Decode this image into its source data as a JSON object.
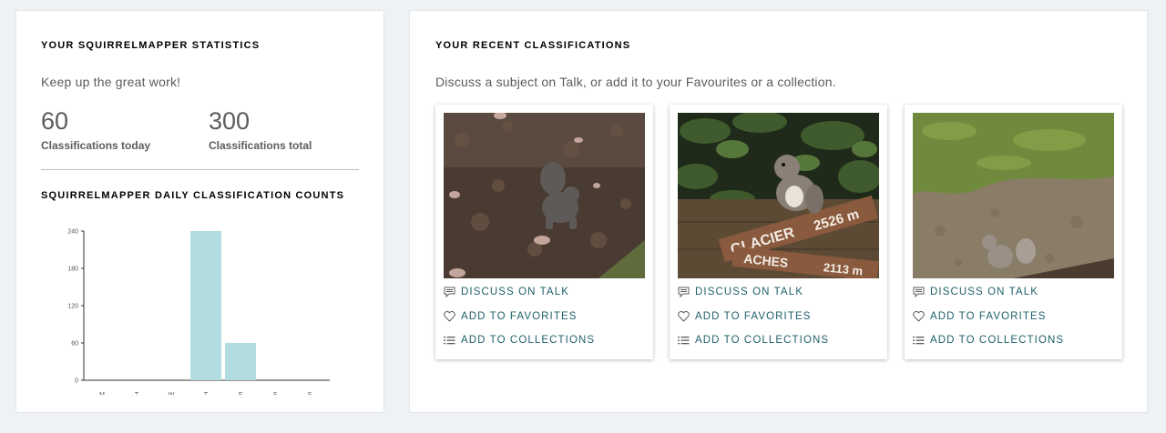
{
  "stats": {
    "heading": "YOUR SQUIRRELMAPPER STATISTICS",
    "subtitle": "Keep up the great work!",
    "today_value": "60",
    "today_label": "Classifications today",
    "total_value": "300",
    "total_label": "Classifications total"
  },
  "daily": {
    "heading": "SQUIRRELMAPPER DAILY CLASSIFICATION COUNTS"
  },
  "chart_data": {
    "type": "bar",
    "categories": [
      "M",
      "T",
      "W",
      "T",
      "F",
      "S",
      "S"
    ],
    "values": [
      0,
      0,
      0,
      240,
      60,
      0,
      0
    ],
    "ylim": [
      0,
      240
    ],
    "yticks": [
      0,
      60,
      120,
      180,
      240
    ],
    "title": "SQUIRRELMAPPER DAILY CLASSIFICATION COUNTS",
    "xlabel": "",
    "ylabel": "",
    "grid": false,
    "bar_color": "#b2dde0"
  },
  "recent": {
    "heading": "YOUR RECENT CLASSIFICATIONS",
    "subtitle": "Discuss a subject on Talk, or add it to your Favourites or a collection.",
    "items": [
      {
        "image": "squirrel in leaf litter",
        "discuss": "DISCUSS ON TALK",
        "favorite": "ADD TO FAVORITES",
        "collect": "ADD TO COLLECTIONS"
      },
      {
        "image": "squirrel on trail sign",
        "discuss": "DISCUSS ON TALK",
        "favorite": "ADD TO FAVORITES",
        "collect": "ADD TO COLLECTIONS"
      },
      {
        "image": "squirrel on grass and dirt",
        "discuss": "DISCUSS ON TALK",
        "favorite": "ADD TO FAVORITES",
        "collect": "ADD TO COLLECTIONS"
      }
    ]
  },
  "sign": {
    "top": "GLACIER",
    "top_distance": "2526 m",
    "bottom": "ACHES",
    "bottom_distance": "2113 m"
  },
  "colors": {
    "link": "#1e5f6a",
    "bar": "#b2dde0",
    "background": "#eff2f5"
  },
  "icons": {
    "discuss": "speech-bubble-icon",
    "favorite": "heart-icon",
    "collect": "list-icon"
  }
}
